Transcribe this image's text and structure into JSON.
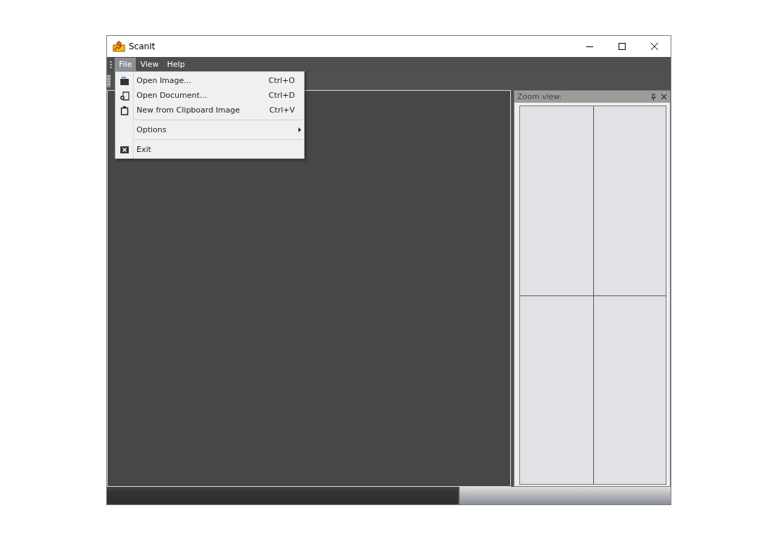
{
  "window": {
    "title": "ScanIt"
  },
  "menu_bar": [
    {
      "label": "File",
      "selected": true
    },
    {
      "label": "View",
      "selected": false
    },
    {
      "label": "Help",
      "selected": false
    }
  ],
  "file_menu": [
    {
      "kind": "item",
      "label": "Open Image...",
      "shortcut": "Ctrl+O"
    },
    {
      "kind": "item",
      "label": "Open Document...",
      "shortcut": "Ctrl+D"
    },
    {
      "kind": "item",
      "label": "New from Clipboard Image",
      "shortcut": "Ctrl+V"
    },
    {
      "kind": "separator"
    },
    {
      "kind": "submenu",
      "label": "Options"
    },
    {
      "kind": "separator"
    },
    {
      "kind": "item",
      "label": "Exit"
    }
  ],
  "zoom_panel": {
    "title": "Zoom view:"
  }
}
